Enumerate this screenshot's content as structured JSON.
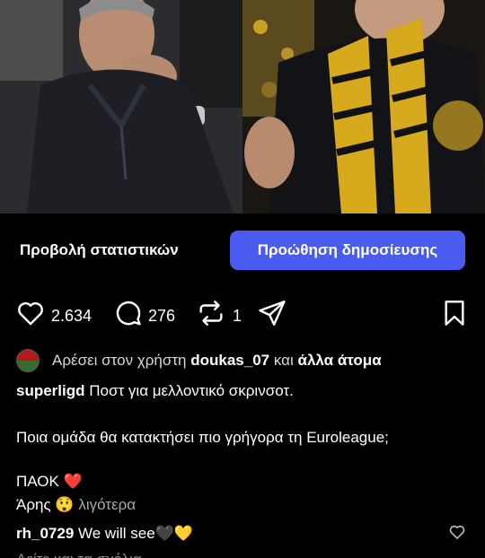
{
  "buttons": {
    "stats_label": "Προβολή στατιστικών",
    "promote_label": "Προώθηση δημοσίευσης"
  },
  "engagement": {
    "likes": "2.634",
    "comments": "276",
    "reposts": "1"
  },
  "liked_by": {
    "prefix": "Αρέσει στον χρήστη",
    "user": "doukas_07",
    "conjunction": "και",
    "others": "άλλα άτομα"
  },
  "caption": {
    "author": "superligd",
    "line1": "Ποστ για μελλοντικό σκρινσοτ.",
    "line2": "Ποια ομάδα θα κατακτήσει πιο γρήγορα τη Euroleague;",
    "option1": "ΠΑΟΚ",
    "option1_emoji": "❤️",
    "option2": "Άρης",
    "option2_emoji": "😲",
    "less_label": "λιγότερα"
  },
  "comment": {
    "user": "rh_0729",
    "text": "We will see",
    "emojis": "🖤💛"
  },
  "partial_line": "Δείτε και τα  σχόλια",
  "colors": {
    "background": "#000000",
    "promote_button": "#4a5bf0",
    "muted_text": "#a8a8a8"
  },
  "icons": [
    "heart-icon",
    "comment-icon",
    "repost-icon",
    "share-icon",
    "bookmark-icon",
    "small-heart-icon"
  ]
}
